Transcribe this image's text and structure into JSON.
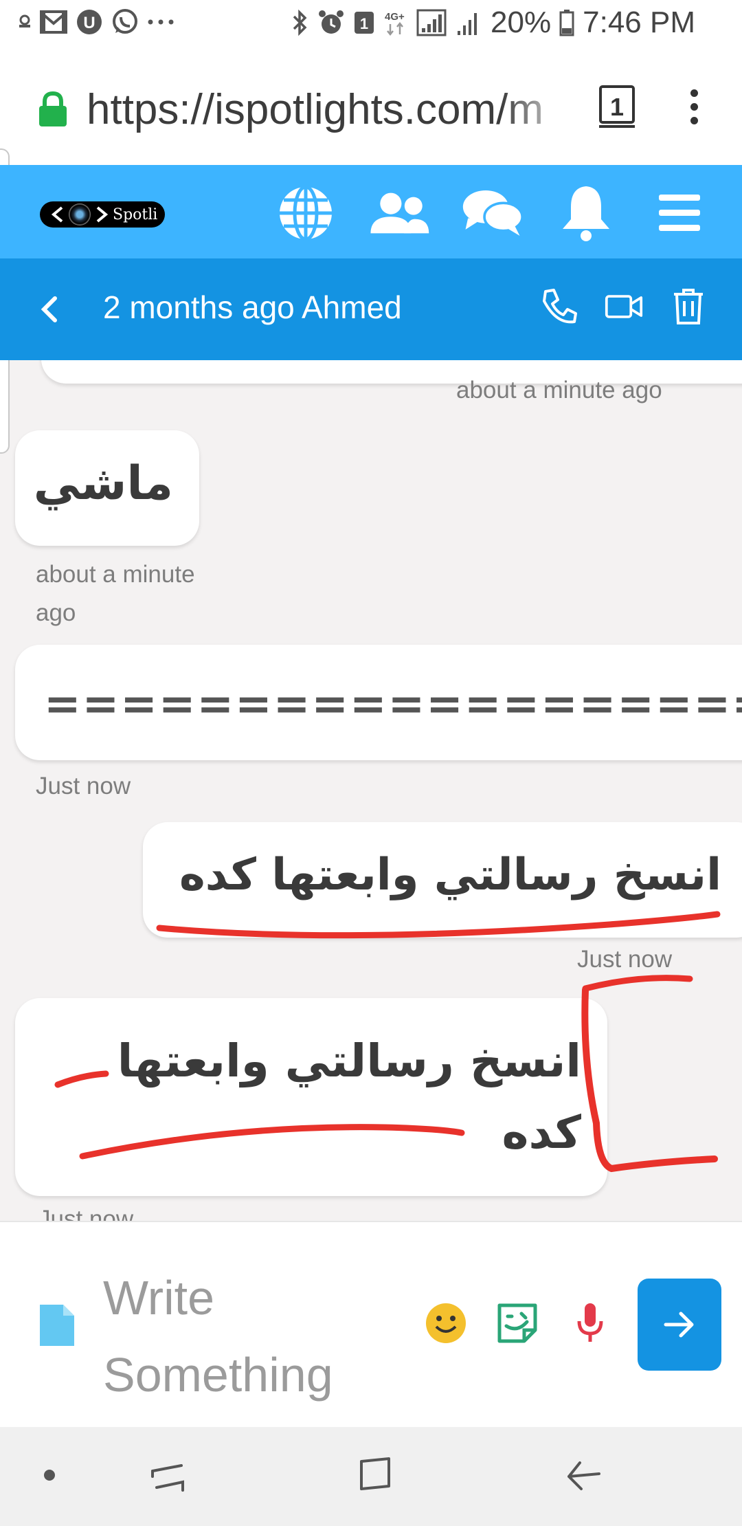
{
  "status_bar": {
    "left_icons": [
      "notification-icon",
      "gmail-icon",
      "u-app-icon",
      "whatsapp-icon",
      "more-notifications-icon"
    ],
    "sim_badge": "1",
    "network": "4G+",
    "battery": "20%",
    "time": "7:46 PM"
  },
  "browser": {
    "url": "https://ispotlights.com/m",
    "tab_count": "1"
  },
  "site_nav": {
    "logo_text": "Spotli",
    "icons": [
      "globe-icon",
      "friends-icon",
      "messages-icon",
      "notifications-bell-icon",
      "menu-icon"
    ]
  },
  "chat_header": {
    "title": "2 months ago Ahmed",
    "actions": [
      "phone-call-icon",
      "video-call-icon",
      "delete-icon"
    ]
  },
  "messages": [
    {
      "side": "right",
      "text": "",
      "time": "about a minute ago"
    },
    {
      "side": "left",
      "text": "ماشي",
      "time_line1": "about a minute",
      "time_line2": "ago"
    },
    {
      "side": "left",
      "text": "=========================",
      "time": "Just now"
    },
    {
      "side": "right",
      "text": "انسخ رسالتي وابعتها كده",
      "time": "Just now"
    },
    {
      "side": "left",
      "text_line1": "انسخ رسالتي وابعتها",
      "text_line2": "كده",
      "time": "Just now"
    }
  ],
  "composer": {
    "placeholder_line1": "Write",
    "placeholder_line2": "Something"
  },
  "annotation_color": "#e8322b",
  "accent_light": "#3db4ff",
  "accent_dark": "#1493e2"
}
